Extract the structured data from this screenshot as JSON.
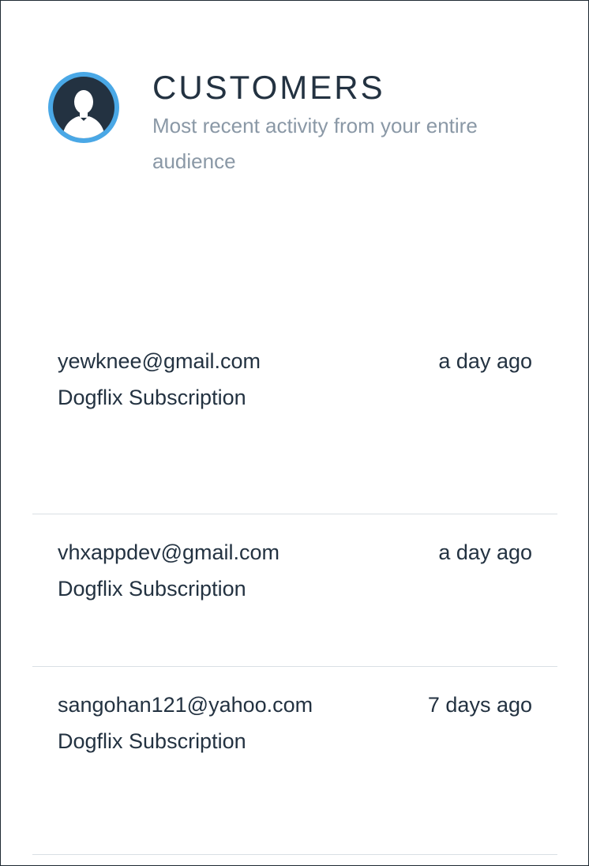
{
  "header": {
    "title": "CUSTOMERS",
    "subtitle": "Most recent activity from your entire audience",
    "icon": "user-avatar-icon",
    "accent_color": "#4aa8e6"
  },
  "customers": [
    {
      "email": "yewknee@gmail.com",
      "product": "Dogflix Subscription",
      "time": "a day ago"
    },
    {
      "email": "vhxappdev@gmail.com",
      "product": "Dogflix Subscription",
      "time": "a day ago"
    },
    {
      "email": "sangohan121@yahoo.com",
      "product": "Dogflix Subscription",
      "time": "7 days ago"
    }
  ]
}
